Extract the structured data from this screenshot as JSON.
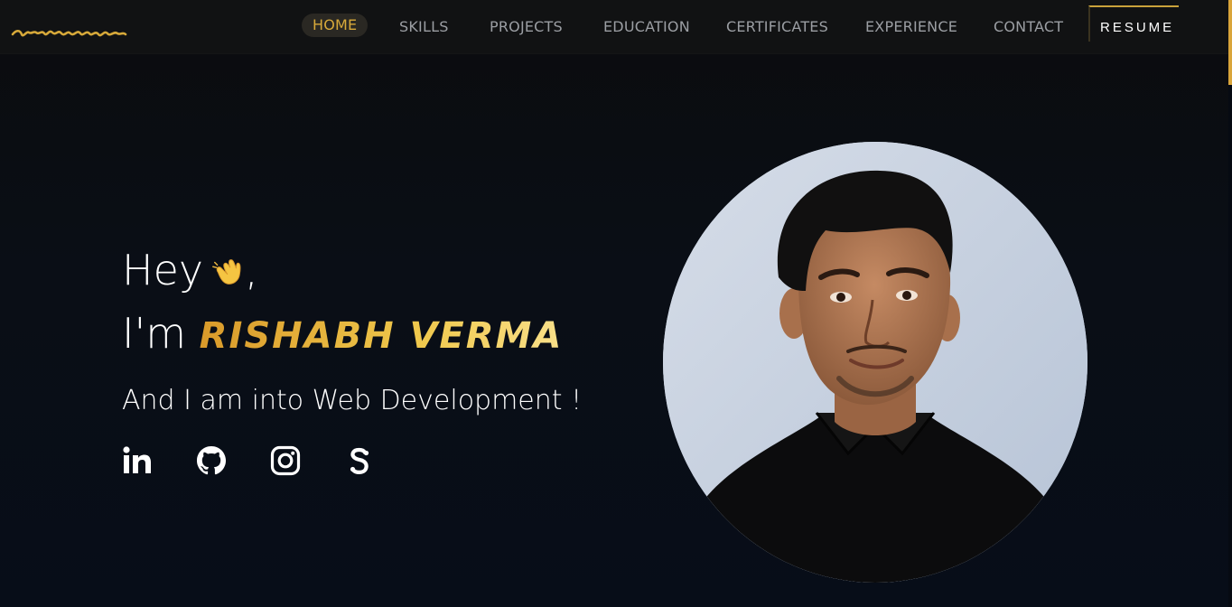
{
  "nav": {
    "links": [
      "HOME",
      "SKILLS",
      "PROJECTS",
      "EDUCATION",
      "CERTIFICATES",
      "EXPERIENCE",
      "CONTACT"
    ],
    "active": "HOME",
    "resume_label": "RESUME"
  },
  "hero": {
    "greeting": "Hey",
    "greeting_suffix": ",",
    "intro_prefix": "I'm",
    "name": "RISHABH VERMA",
    "tagline": "And I am into Web Development !"
  },
  "social": [
    "linkedin-icon",
    "github-icon",
    "instagram-icon",
    "scribd-icon"
  ],
  "colors": {
    "accent": "#d7a93a",
    "nav_bg": "#111213",
    "page_bg": "#070d18"
  }
}
